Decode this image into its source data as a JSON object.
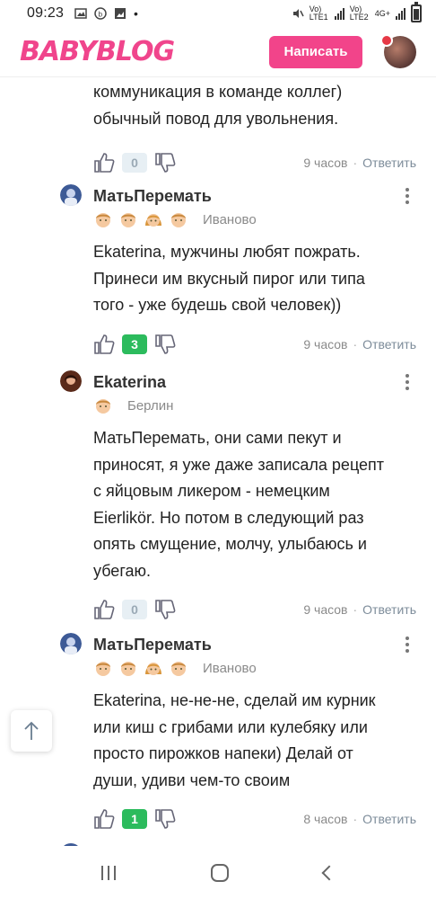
{
  "status_bar": {
    "time": "09:23",
    "sim1": "Vo) LTE1",
    "sim2": "Vo) LTE2",
    "network": "4G+"
  },
  "header": {
    "logo": "BABYBLOG",
    "write_label": "Написать"
  },
  "top_partial": {
    "lines": [
      "коммуникация в команде коллег)",
      "обычный повод для увольнения."
    ],
    "votes": "0",
    "time": "9 часов",
    "reply": "Ответить"
  },
  "comments": [
    {
      "author": "МатьПеремать",
      "badges": [
        "boy-icon",
        "boy-icon",
        "girl-icon",
        "boy-icon"
      ],
      "city": "Иваново",
      "lines": [
        "Ekaterina, мужчины любят пожрать.",
        "Принеси им вкусный пирог или типа",
        "того - уже будешь свой человек))"
      ],
      "votes": "3",
      "time": "9 часов",
      "reply": "Ответить"
    },
    {
      "author": "Ekaterina",
      "badges": [
        "boy-icon"
      ],
      "city": "Берлин",
      "lines": [
        "МатьПеремать, они сами пекут и",
        "приносят, я уже даже записала рецепт",
        "с яйцовым ликером - немецким",
        "Eierlikör. Но потом в следующий раз",
        "опять смущение, молчу, улыбаюсь и",
        "убегаю."
      ],
      "votes": "0",
      "time": "9 часов",
      "reply": "Ответить"
    },
    {
      "author": "МатьПеремать",
      "badges": [
        "boy-icon",
        "boy-icon",
        "girl-icon",
        "boy-icon"
      ],
      "city": "Иваново",
      "lines": [
        "Ekaterina, не-не-не, сделай им курник",
        "или киш с грибами или кулебяку или",
        "просто пирожков напеки) Делай от",
        "души, удиви чем-то своим"
      ],
      "votes": "1",
      "time": "8 часов",
      "reply": "Ответить"
    }
  ],
  "colors": {
    "brand": "#f0458c",
    "button": "#f2448a",
    "vote_positive": "#2cbb5d",
    "vote_zero_bg": "#e7eff4"
  }
}
